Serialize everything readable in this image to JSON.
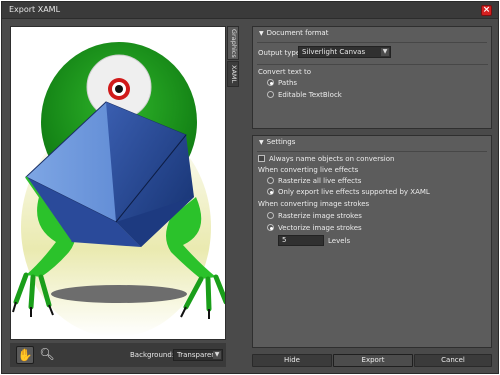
{
  "window": {
    "title": "Export XAML"
  },
  "side_tabs": [
    "Graphics",
    "XAML"
  ],
  "bottom": {
    "background_label": "Background:",
    "background_value": "Transparent"
  },
  "document_format": {
    "header": "Document format",
    "output_type_label": "Output type",
    "output_type_value": "Silverlight Canvas",
    "convert_text_label": "Convert text to",
    "options": [
      "Paths",
      "Editable TextBlock"
    ],
    "selected": "Paths"
  },
  "settings": {
    "header": "Settings",
    "always_name": "Always name objects on conversion",
    "live_effects_label": "When converting live effects",
    "live_effects_options": [
      "Rasterize all live effects",
      "Only export live effects supported by XAML"
    ],
    "live_effects_selected": "Only export live effects supported by XAML",
    "image_strokes_label": "When converting image strokes",
    "image_strokes_options": [
      "Rasterize image strokes",
      "Vectorize image strokes"
    ],
    "image_strokes_selected": "Vectorize image strokes",
    "levels_value": "5",
    "levels_label": "Levels"
  },
  "buttons": {
    "hide": "Hide",
    "export": "Export",
    "cancel": "Cancel"
  },
  "icons": {
    "close": "close-icon",
    "hand": "hand-icon",
    "zoom": "zoom-icon"
  }
}
